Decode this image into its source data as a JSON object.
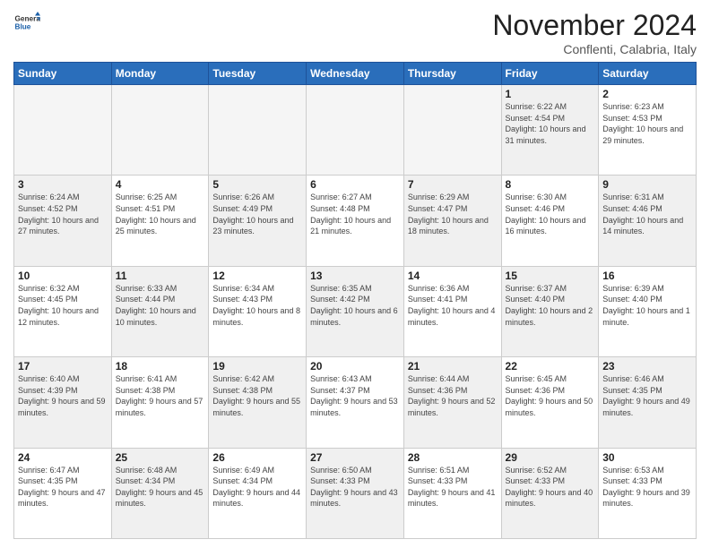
{
  "logo": {
    "general": "General",
    "blue": "Blue"
  },
  "title": "November 2024",
  "subtitle": "Conflenti, Calabria, Italy",
  "days_header": [
    "Sunday",
    "Monday",
    "Tuesday",
    "Wednesday",
    "Thursday",
    "Friday",
    "Saturday"
  ],
  "weeks": [
    [
      {
        "day": "",
        "info": "",
        "empty": true
      },
      {
        "day": "",
        "info": "",
        "empty": true
      },
      {
        "day": "",
        "info": "",
        "empty": true
      },
      {
        "day": "",
        "info": "",
        "empty": true
      },
      {
        "day": "",
        "info": "",
        "empty": true
      },
      {
        "day": "1",
        "info": "Sunrise: 6:22 AM\nSunset: 4:54 PM\nDaylight: 10 hours and 31 minutes.",
        "shaded": true
      },
      {
        "day": "2",
        "info": "Sunrise: 6:23 AM\nSunset: 4:53 PM\nDaylight: 10 hours and 29 minutes.",
        "shaded": false
      }
    ],
    [
      {
        "day": "3",
        "info": "Sunrise: 6:24 AM\nSunset: 4:52 PM\nDaylight: 10 hours and 27 minutes.",
        "shaded": true
      },
      {
        "day": "4",
        "info": "Sunrise: 6:25 AM\nSunset: 4:51 PM\nDaylight: 10 hours and 25 minutes.",
        "shaded": false
      },
      {
        "day": "5",
        "info": "Sunrise: 6:26 AM\nSunset: 4:49 PM\nDaylight: 10 hours and 23 minutes.",
        "shaded": true
      },
      {
        "day": "6",
        "info": "Sunrise: 6:27 AM\nSunset: 4:48 PM\nDaylight: 10 hours and 21 minutes.",
        "shaded": false
      },
      {
        "day": "7",
        "info": "Sunrise: 6:29 AM\nSunset: 4:47 PM\nDaylight: 10 hours and 18 minutes.",
        "shaded": true
      },
      {
        "day": "8",
        "info": "Sunrise: 6:30 AM\nSunset: 4:46 PM\nDaylight: 10 hours and 16 minutes.",
        "shaded": false
      },
      {
        "day": "9",
        "info": "Sunrise: 6:31 AM\nSunset: 4:46 PM\nDaylight: 10 hours and 14 minutes.",
        "shaded": true
      }
    ],
    [
      {
        "day": "10",
        "info": "Sunrise: 6:32 AM\nSunset: 4:45 PM\nDaylight: 10 hours and 12 minutes.",
        "shaded": false
      },
      {
        "day": "11",
        "info": "Sunrise: 6:33 AM\nSunset: 4:44 PM\nDaylight: 10 hours and 10 minutes.",
        "shaded": true
      },
      {
        "day": "12",
        "info": "Sunrise: 6:34 AM\nSunset: 4:43 PM\nDaylight: 10 hours and 8 minutes.",
        "shaded": false
      },
      {
        "day": "13",
        "info": "Sunrise: 6:35 AM\nSunset: 4:42 PM\nDaylight: 10 hours and 6 minutes.",
        "shaded": true
      },
      {
        "day": "14",
        "info": "Sunrise: 6:36 AM\nSunset: 4:41 PM\nDaylight: 10 hours and 4 minutes.",
        "shaded": false
      },
      {
        "day": "15",
        "info": "Sunrise: 6:37 AM\nSunset: 4:40 PM\nDaylight: 10 hours and 2 minutes.",
        "shaded": true
      },
      {
        "day": "16",
        "info": "Sunrise: 6:39 AM\nSunset: 4:40 PM\nDaylight: 10 hours and 1 minute.",
        "shaded": false
      }
    ],
    [
      {
        "day": "17",
        "info": "Sunrise: 6:40 AM\nSunset: 4:39 PM\nDaylight: 9 hours and 59 minutes.",
        "shaded": true
      },
      {
        "day": "18",
        "info": "Sunrise: 6:41 AM\nSunset: 4:38 PM\nDaylight: 9 hours and 57 minutes.",
        "shaded": false
      },
      {
        "day": "19",
        "info": "Sunrise: 6:42 AM\nSunset: 4:38 PM\nDaylight: 9 hours and 55 minutes.",
        "shaded": true
      },
      {
        "day": "20",
        "info": "Sunrise: 6:43 AM\nSunset: 4:37 PM\nDaylight: 9 hours and 53 minutes.",
        "shaded": false
      },
      {
        "day": "21",
        "info": "Sunrise: 6:44 AM\nSunset: 4:36 PM\nDaylight: 9 hours and 52 minutes.",
        "shaded": true
      },
      {
        "day": "22",
        "info": "Sunrise: 6:45 AM\nSunset: 4:36 PM\nDaylight: 9 hours and 50 minutes.",
        "shaded": false
      },
      {
        "day": "23",
        "info": "Sunrise: 6:46 AM\nSunset: 4:35 PM\nDaylight: 9 hours and 49 minutes.",
        "shaded": true
      }
    ],
    [
      {
        "day": "24",
        "info": "Sunrise: 6:47 AM\nSunset: 4:35 PM\nDaylight: 9 hours and 47 minutes.",
        "shaded": false
      },
      {
        "day": "25",
        "info": "Sunrise: 6:48 AM\nSunset: 4:34 PM\nDaylight: 9 hours and 45 minutes.",
        "shaded": true
      },
      {
        "day": "26",
        "info": "Sunrise: 6:49 AM\nSunset: 4:34 PM\nDaylight: 9 hours and 44 minutes.",
        "shaded": false
      },
      {
        "day": "27",
        "info": "Sunrise: 6:50 AM\nSunset: 4:33 PM\nDaylight: 9 hours and 43 minutes.",
        "shaded": true
      },
      {
        "day": "28",
        "info": "Sunrise: 6:51 AM\nSunset: 4:33 PM\nDaylight: 9 hours and 41 minutes.",
        "shaded": false
      },
      {
        "day": "29",
        "info": "Sunrise: 6:52 AM\nSunset: 4:33 PM\nDaylight: 9 hours and 40 minutes.",
        "shaded": true
      },
      {
        "day": "30",
        "info": "Sunrise: 6:53 AM\nSunset: 4:33 PM\nDaylight: 9 hours and 39 minutes.",
        "shaded": false
      }
    ]
  ]
}
